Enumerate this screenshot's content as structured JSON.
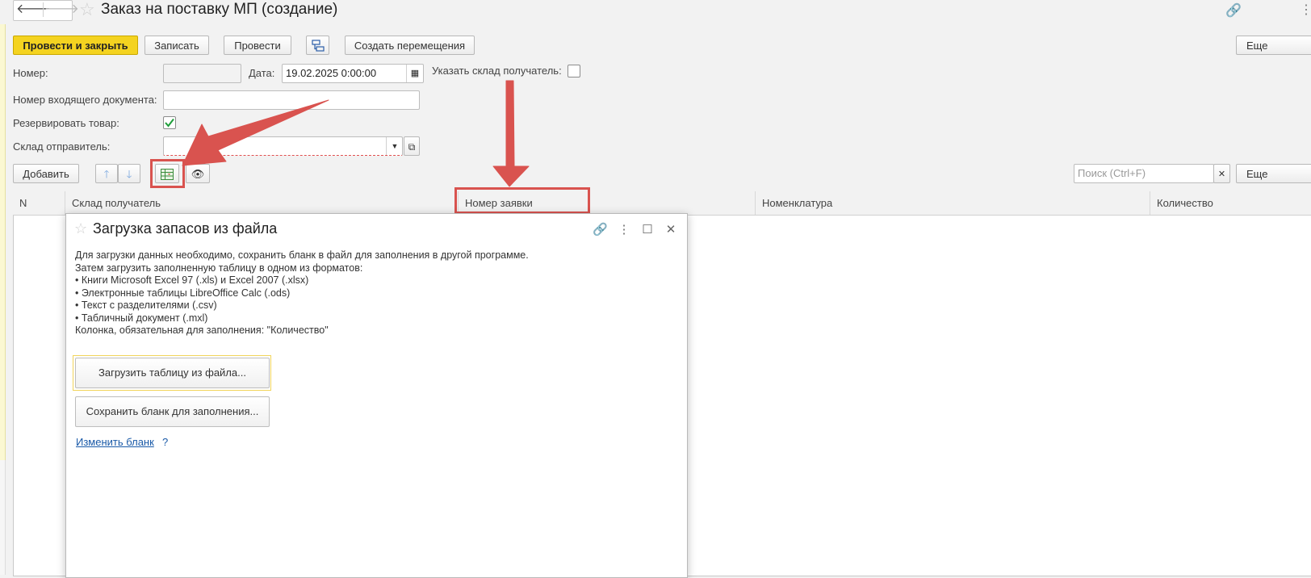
{
  "window": {
    "title": "Заказ на поставку МП (создание)"
  },
  "toolbar": {
    "post_close": "Провести и закрыть",
    "save": "Записать",
    "post": "Провести",
    "create_moves": "Создать перемещения",
    "more": "Еще"
  },
  "form": {
    "number_label": "Номер:",
    "number_value": "",
    "date_label": "Дата:",
    "date_value": "19.02.2025  0:00:00",
    "specify_warehouse_label": "Указать склад получатель:",
    "incoming_doc_label": "Номер входящего документа:",
    "incoming_doc_value": "",
    "reserve_label": "Резервировать товар:",
    "reserve_checked": true,
    "sender_warehouse_label": "Склад отправитель:",
    "sender_warehouse_value": ""
  },
  "table_toolbar": {
    "add": "Добавить",
    "search_placeholder": "Поиск (Ctrl+F)",
    "more": "Еще"
  },
  "table": {
    "columns": [
      "N",
      "Склад получатель",
      "Номер заявки",
      "Номенклатура",
      "Количество"
    ]
  },
  "dialog": {
    "title": "Загрузка запасов из файла",
    "lines": [
      "Для загрузки данных необходимо, сохранить бланк в файл для заполнения в другой программе.",
      "Затем загрузить заполненную таблицу в одном из форматов:",
      "• Книги Microsoft Excel 97 (.xls) и Excel 2007 (.xlsx)",
      "• Электронные таблицы LibreOffice Calc (.ods)",
      "• Текст с разделителями (.csv)",
      "• Табличный документ (.mxl)",
      "Колонка, обязательная для заполнения: \"Количество\""
    ],
    "load_button": "Загрузить таблицу из файла...",
    "save_button": "Сохранить бланк для заполнения...",
    "change_link": "Изменить бланк",
    "help": "?"
  },
  "colors": {
    "primary": "#f4d320",
    "annotation": "#d9534f",
    "link": "#1a5aa8"
  }
}
